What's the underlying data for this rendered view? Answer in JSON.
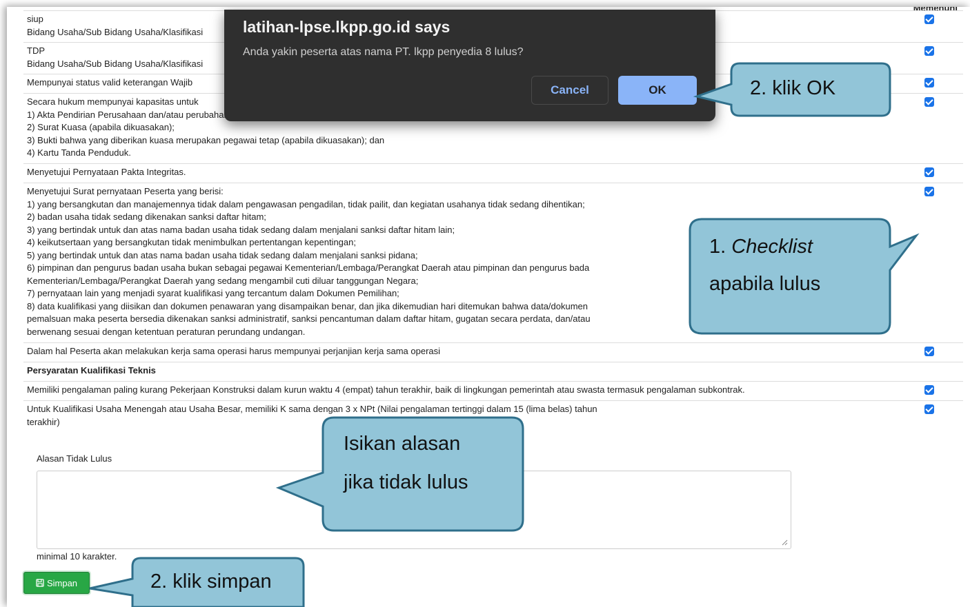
{
  "header_right": "Memenuhi",
  "rows": [
    {
      "text": "siup\nBidang Usaha/Sub Bidang Usaha/Klasifikasi",
      "checked": true
    },
    {
      "text": "TDP\nBidang Usaha/Sub Bidang Usaha/Klasifikasi",
      "checked": true
    },
    {
      "text": "Mempunyai status valid keterangan Wajib",
      "checked": true
    },
    {
      "text": "Secara hukum mempunyai kapasitas untuk\n1) Akta Pendirian Perusahaan dan/atau perubahannya;\n2) Surat Kuasa (apabila dikuasakan);\n3) Bukti bahwa yang diberikan kuasa merupakan pegawai tetap (apabila dikuasakan); dan\n4) Kartu Tanda Penduduk.",
      "checked": true
    },
    {
      "text": "Menyetujui Pernyataan Pakta Integritas.",
      "checked": true
    },
    {
      "text": "Menyetujui Surat pernyataan Peserta yang berisi:\n1) yang bersangkutan dan manajemennya tidak dalam pengawasan pengadilan, tidak pailit, dan kegiatan usahanya tidak sedang dihentikan;\n2) badan usaha tidak sedang dikenakan sanksi daftar hitam;\n3) yang bertindak untuk dan atas nama badan usaha tidak sedang dalam menjalani sanksi daftar hitam lain;\n4) keikutsertaan yang bersangkutan tidak menimbulkan pertentangan kepentingan;\n5) yang bertindak untuk dan atas nama badan usaha tidak sedang dalam menjalani sanksi pidana;\n6) pimpinan dan pengurus badan usaha bukan sebagai pegawai Kementerian/Lembaga/Perangkat Daerah atau pimpinan dan pengurus bada\nKementerian/Lembaga/Perangkat Daerah yang sedang mengambil cuti diluar tanggungan Negara;\n7) pernyataan lain yang menjadi syarat kualifikasi yang tercantum dalam Dokumen Pemilihan;\n8) data kualifikasi yang diisikan dan dokumen penawaran yang disampaikan benar, dan jika dikemudian hari ditemukan bahwa data/dokumen\npemalsuan maka peserta bersedia dikenakan sanksi administratif, sanksi pencantuman dalam daftar hitam, gugatan secara perdata, dan/atau\nberwenang sesuai dengan ketentuan peraturan perundang undangan.",
      "checked": true
    },
    {
      "text": "Dalam hal Peserta akan melakukan kerja sama operasi harus mempunyai perjanjian kerja sama operasi",
      "checked": true
    },
    {
      "text": "Persyaratan Kualifikasi Teknis",
      "checked": false,
      "section": true
    },
    {
      "text": "Memiliki pengalaman paling kurang Pekerjaan Konstruksi dalam kurun waktu 4 (empat) tahun terakhir, baik di lingkungan pemerintah atau swasta termasuk pengalaman subkontrak.",
      "checked": true
    },
    {
      "text": "Untuk Kualifikasi Usaha Menengah atau Usaha Besar, memiliki K sama dengan 3 x NPt (Nilai pengalaman tertinggi dalam 15 (lima belas) tahun\nterakhir)",
      "checked": true
    }
  ],
  "form": {
    "alasan_label": "Alasan Tidak Lulus",
    "alasan_value": "",
    "min_text": "minimal 10 karakter.",
    "simpan_label": "Simpan"
  },
  "dialog": {
    "title": "latihan-lpse.lkpp.go.id says",
    "message": "Anda yakin peserta atas nama PT. lkpp penyedia 8 lulus?",
    "cancel_label": "Cancel",
    "ok_label": "OK"
  },
  "callouts": {
    "ok": "2. klik OK",
    "checklist_num": "1. ",
    "checklist_word": "Checklist",
    "checklist_line2": "apabila lulus",
    "alasan_line1": "Isikan alasan",
    "alasan_line2": "jika tidak lulus",
    "simpan": "2. klik simpan"
  },
  "colors": {
    "callout_fill": "#92c5d8",
    "callout_stroke": "#2f6f8b",
    "checkbox": "#1a73e8",
    "simpan_button": "#28a745",
    "dialog_bg": "#2f2f2f",
    "ok_button": "#8ab4f8"
  }
}
